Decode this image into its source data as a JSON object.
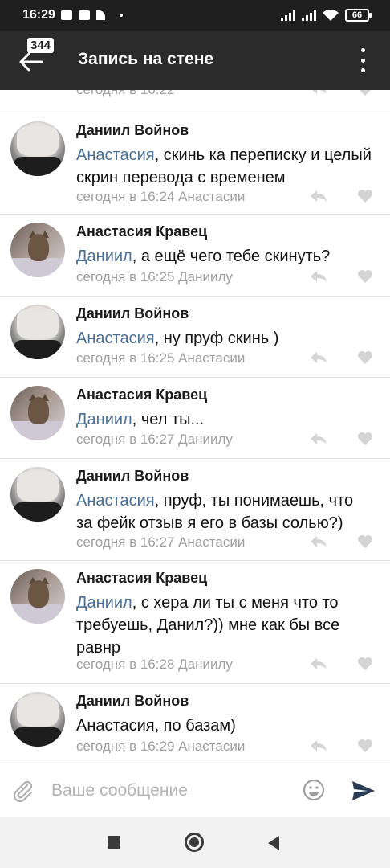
{
  "status_bar": {
    "time": "16:29",
    "battery": "66"
  },
  "header": {
    "back_count": "344",
    "title": "Запись на стене"
  },
  "partial_meta": "сегодня в 16:22",
  "comments": [
    {
      "author": "Даниил Войнов",
      "mention": "Анастасия",
      "text": ", скинь ка переписку и целый скрин перевода с временем",
      "meta": "сегодня в 16:24 Анастасии"
    },
    {
      "author": "Анастасия Кравец",
      "mention": "Даниил",
      "text": ", а ещё чего тебе скинуть?",
      "meta": "сегодня в 16:25 Даниилу"
    },
    {
      "author": "Даниил Войнов",
      "mention": "Анастасия",
      "text": ", ну пруф скинь )",
      "meta": "сегодня в 16:25 Анастасии"
    },
    {
      "author": "Анастасия Кравец",
      "mention": "Даниил",
      "text": ", чел ты...",
      "meta": "сегодня в 16:27 Даниилу"
    },
    {
      "author": "Даниил Войнов",
      "mention": "Анастасия",
      "text": ", пруф, ты понимаешь, что за фейк отзыв я его в базы солью?)",
      "meta": "сегодня в 16:27 Анастасии"
    },
    {
      "author": "Анастасия Кравец",
      "mention": "Даниил",
      "text": ", с хера ли ты с меня что то требуешь, Данил?)) мне как бы все равнр",
      "meta": "сегодня в 16:28 Даниилу"
    },
    {
      "author": "Даниил Войнов",
      "mention": "",
      "text": "Анастасия, по базам)",
      "meta": "сегодня в 16:29 Анастасии"
    }
  ],
  "composer": {
    "placeholder": "Ваше сообщение"
  }
}
